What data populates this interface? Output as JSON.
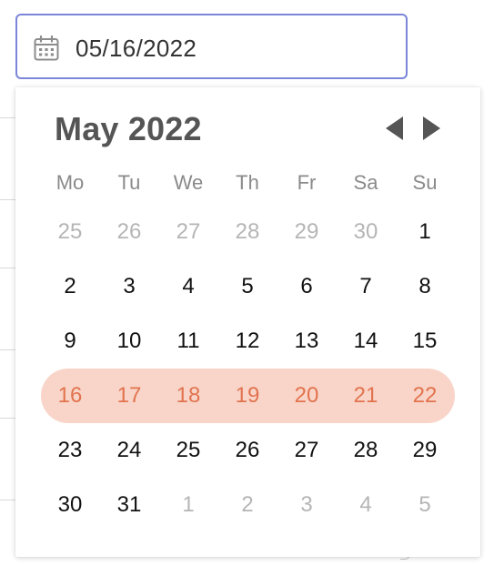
{
  "date_field": {
    "value": "05/16/2022",
    "icon": "calendar-icon"
  },
  "calendar": {
    "month_title": "May 2022",
    "prev_icon": "triangle-left-icon",
    "next_icon": "triangle-right-icon",
    "weekdays": [
      "Mo",
      "Tu",
      "We",
      "Th",
      "Fr",
      "Sa",
      "Su"
    ],
    "weeks": [
      [
        {
          "label": "25",
          "muted": true
        },
        {
          "label": "26",
          "muted": true
        },
        {
          "label": "27",
          "muted": true
        },
        {
          "label": "28",
          "muted": true
        },
        {
          "label": "29",
          "muted": true
        },
        {
          "label": "30",
          "muted": true
        },
        {
          "label": "1",
          "muted": false
        }
      ],
      [
        {
          "label": "2",
          "muted": false
        },
        {
          "label": "3",
          "muted": false
        },
        {
          "label": "4",
          "muted": false
        },
        {
          "label": "5",
          "muted": false
        },
        {
          "label": "6",
          "muted": false
        },
        {
          "label": "7",
          "muted": false
        },
        {
          "label": "8",
          "muted": false
        }
      ],
      [
        {
          "label": "9",
          "muted": false
        },
        {
          "label": "10",
          "muted": false
        },
        {
          "label": "11",
          "muted": false
        },
        {
          "label": "12",
          "muted": false
        },
        {
          "label": "13",
          "muted": false
        },
        {
          "label": "14",
          "muted": false
        },
        {
          "label": "15",
          "muted": false
        }
      ],
      [
        {
          "label": "16",
          "muted": false
        },
        {
          "label": "17",
          "muted": false
        },
        {
          "label": "18",
          "muted": false
        },
        {
          "label": "19",
          "muted": false
        },
        {
          "label": "20",
          "muted": false
        },
        {
          "label": "21",
          "muted": false
        },
        {
          "label": "22",
          "muted": false
        }
      ],
      [
        {
          "label": "23",
          "muted": false
        },
        {
          "label": "24",
          "muted": false
        },
        {
          "label": "25",
          "muted": false
        },
        {
          "label": "26",
          "muted": false
        },
        {
          "label": "27",
          "muted": false
        },
        {
          "label": "28",
          "muted": false
        },
        {
          "label": "29",
          "muted": false
        }
      ],
      [
        {
          "label": "30",
          "muted": false
        },
        {
          "label": "31",
          "muted": false
        },
        {
          "label": "1",
          "muted": true
        },
        {
          "label": "2",
          "muted": true
        },
        {
          "label": "3",
          "muted": true
        },
        {
          "label": "4",
          "muted": true
        },
        {
          "label": "5",
          "muted": true
        }
      ]
    ],
    "selected_week_index": 3
  },
  "colors": {
    "input_border": "#7b86d8",
    "highlight_bg": "#f8d5c8",
    "highlight_text": "#e2734f",
    "muted_text": "#b5b5b5",
    "title_text": "#555555"
  }
}
